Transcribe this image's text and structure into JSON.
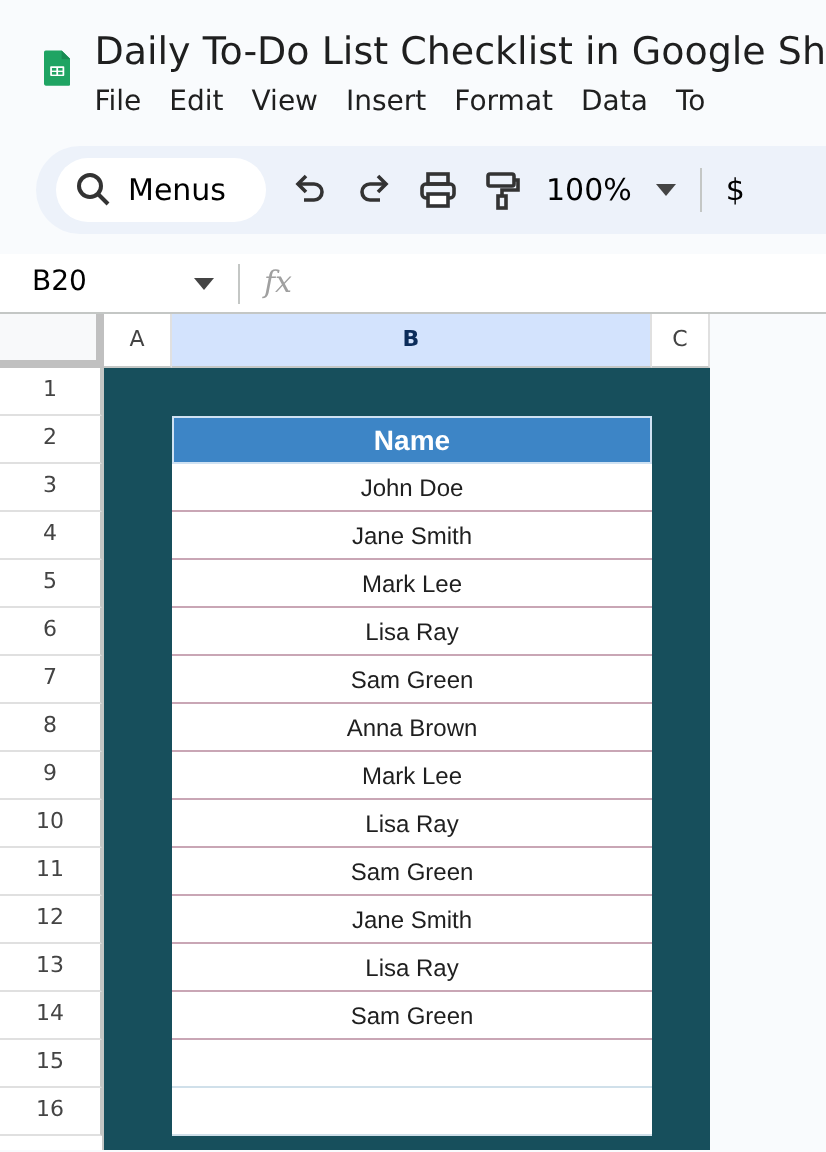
{
  "document": {
    "title": "Daily To-Do List Checklist in Google Sh"
  },
  "menu": [
    "File",
    "Edit",
    "View",
    "Insert",
    "Format",
    "Data",
    "To"
  ],
  "toolbar": {
    "search": "Menus",
    "zoom": "100%",
    "currency": "$"
  },
  "formula_bar": {
    "name_box": "B20",
    "fx": "fx"
  },
  "columns": [
    {
      "label": "A",
      "selected": false
    },
    {
      "label": "B",
      "selected": true
    },
    {
      "label": "C",
      "selected": false
    }
  ],
  "rows": [
    {
      "number": "1",
      "kind": "band"
    },
    {
      "number": "2",
      "kind": "header",
      "text": "Name"
    },
    {
      "number": "3",
      "kind": "entry",
      "text": "John Doe"
    },
    {
      "number": "4",
      "kind": "entry",
      "text": "Jane Smith"
    },
    {
      "number": "5",
      "kind": "entry",
      "text": "Mark Lee"
    },
    {
      "number": "6",
      "kind": "entry",
      "text": "Lisa Ray"
    },
    {
      "number": "7",
      "kind": "entry",
      "text": "Sam Green"
    },
    {
      "number": "8",
      "kind": "entry",
      "text": "Anna Brown"
    },
    {
      "number": "9",
      "kind": "entry",
      "text": "Mark Lee"
    },
    {
      "number": "10",
      "kind": "entry",
      "text": "Lisa Ray"
    },
    {
      "number": "11",
      "kind": "entry",
      "text": "Sam Green"
    },
    {
      "number": "12",
      "kind": "entry",
      "text": "Jane Smith"
    },
    {
      "number": "13",
      "kind": "entry",
      "text": "Lisa Ray"
    },
    {
      "number": "14",
      "kind": "entry",
      "text": "Sam Green"
    },
    {
      "number": "15",
      "kind": "blank"
    },
    {
      "number": "16",
      "kind": "blank"
    }
  ]
}
